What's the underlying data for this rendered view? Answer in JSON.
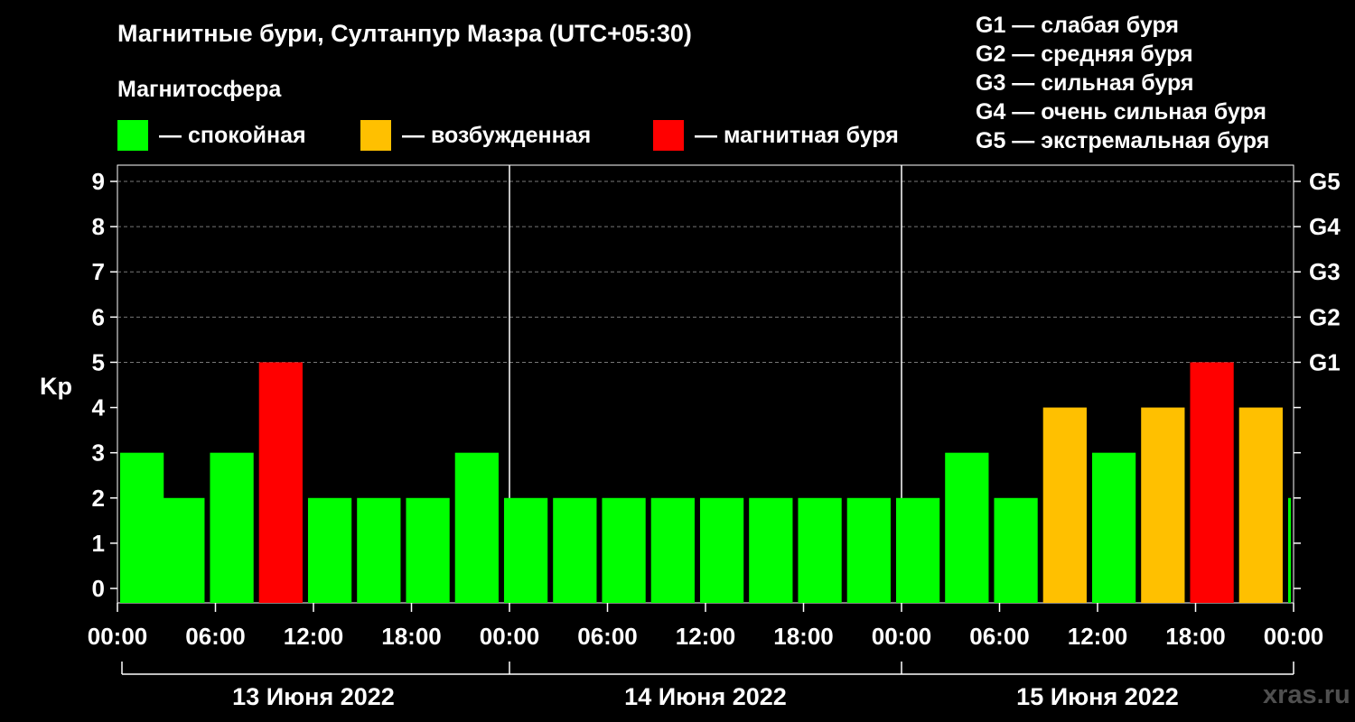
{
  "header": {
    "title": "Магнитные бури, Султанпур Мазра (UTC+05:30)",
    "subtitle": "Магнитосфера"
  },
  "legend": {
    "items": [
      {
        "label": "— спокойная",
        "color": "#00ff00"
      },
      {
        "label": "— возбужденная",
        "color": "#ffc000"
      },
      {
        "label": "— магнитная буря",
        "color": "#ff0000"
      }
    ]
  },
  "g_legend": [
    "G1 — слабая буря",
    "G2 — средняя буря",
    "G3 — сильная буря",
    "G4 — очень сильная буря",
    "G5 — экстремальная буря"
  ],
  "watermark": "xras.ru",
  "chart_data": {
    "type": "bar",
    "ylabel": "Kp",
    "ylim": [
      0,
      9
    ],
    "yticks": [
      "0",
      "1",
      "2",
      "3",
      "4",
      "5",
      "6",
      "7",
      "8",
      "9"
    ],
    "right_ticks": [
      {
        "label": "G1",
        "value": 5
      },
      {
        "label": "G2",
        "value": 6
      },
      {
        "label": "G3",
        "value": 7
      },
      {
        "label": "G4",
        "value": 8
      },
      {
        "label": "G5",
        "value": 9
      }
    ],
    "xticks": [
      "00:00",
      "06:00",
      "12:00",
      "18:00",
      "00:00",
      "06:00",
      "12:00",
      "18:00",
      "00:00",
      "06:00",
      "12:00",
      "18:00",
      "00:00"
    ],
    "days": [
      "13 Июня 2022",
      "14 Июня 2022",
      "15 Июня 2022"
    ],
    "colors": {
      "quiet": "#00ff00",
      "active": "#ffc000",
      "storm": "#ff0000"
    },
    "grid": true,
    "bars": [
      {
        "start": "00:00",
        "kp": 3,
        "level": "quiet"
      },
      {
        "start": "02:30",
        "kp": 2,
        "level": "quiet"
      },
      {
        "start": "05:30",
        "kp": 3,
        "level": "quiet"
      },
      {
        "start": "08:30",
        "kp": 5,
        "level": "storm"
      },
      {
        "start": "11:30",
        "kp": 2,
        "level": "quiet"
      },
      {
        "start": "14:30",
        "kp": 2,
        "level": "quiet"
      },
      {
        "start": "17:30",
        "kp": 2,
        "level": "quiet"
      },
      {
        "start": "20:30",
        "kp": 3,
        "level": "quiet"
      },
      {
        "start": "23:30",
        "kp": 2,
        "level": "quiet"
      },
      {
        "start": "02:30",
        "kp": 2,
        "level": "quiet"
      },
      {
        "start": "05:30",
        "kp": 2,
        "level": "quiet"
      },
      {
        "start": "08:30",
        "kp": 2,
        "level": "quiet"
      },
      {
        "start": "11:30",
        "kp": 2,
        "level": "quiet"
      },
      {
        "start": "14:30",
        "kp": 2,
        "level": "quiet"
      },
      {
        "start": "17:30",
        "kp": 2,
        "level": "quiet"
      },
      {
        "start": "20:30",
        "kp": 2,
        "level": "quiet"
      },
      {
        "start": "23:30",
        "kp": 2,
        "level": "quiet"
      },
      {
        "start": "02:30",
        "kp": 3,
        "level": "quiet"
      },
      {
        "start": "05:30",
        "kp": 2,
        "level": "quiet"
      },
      {
        "start": "08:30",
        "kp": 4,
        "level": "active"
      },
      {
        "start": "11:30",
        "kp": 3,
        "level": "quiet"
      },
      {
        "start": "14:30",
        "kp": 4,
        "level": "active"
      },
      {
        "start": "17:30",
        "kp": 5,
        "level": "storm"
      },
      {
        "start": "20:30",
        "kp": 4,
        "level": "active"
      },
      {
        "start": "23:30",
        "kp": 2,
        "level": "quiet"
      }
    ]
  }
}
